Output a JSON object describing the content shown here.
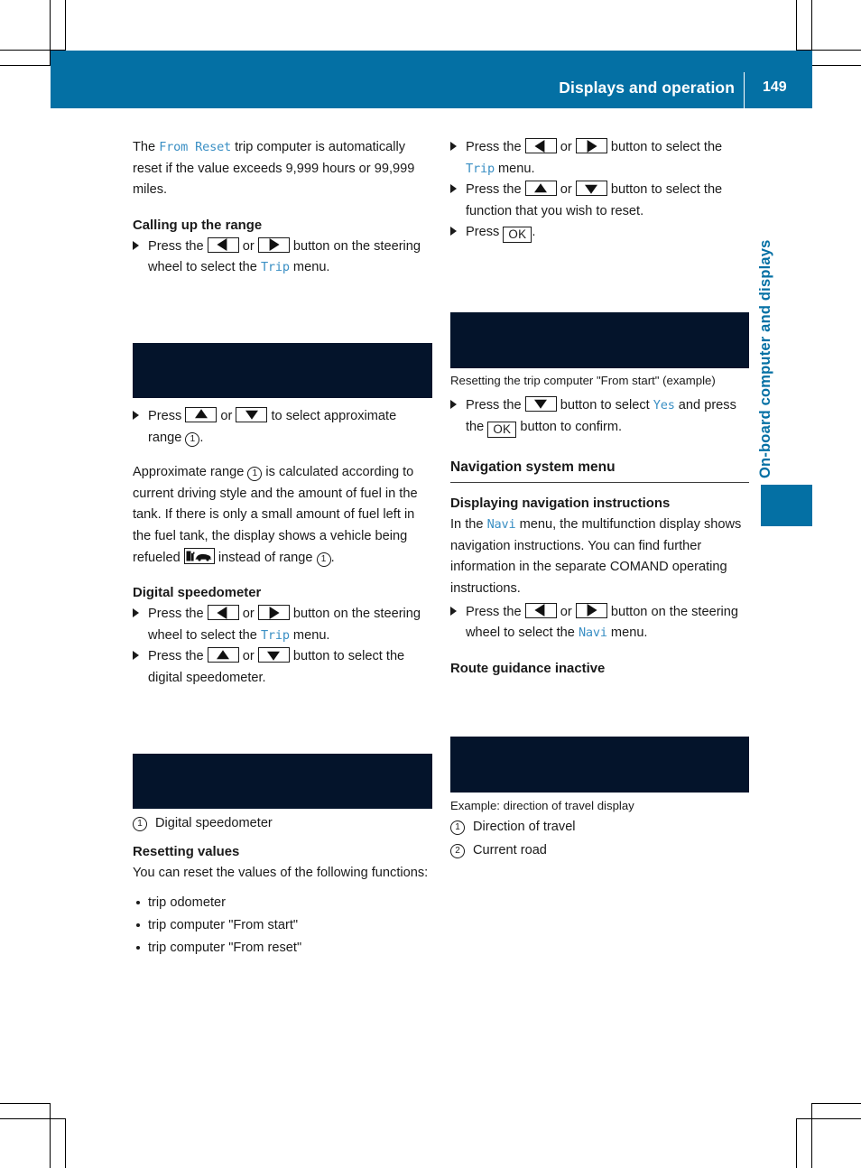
{
  "header": {
    "title": "Displays and operation",
    "page_number": "149"
  },
  "side_tab": {
    "label": "On-board computer and displays"
  },
  "left_column": {
    "intro": {
      "before": "The ",
      "code": "From Reset",
      "after": " trip computer is automatically reset if the value exceeds 9,999 hours or 99,999 miles."
    },
    "heading_calling_range": "Calling up the range",
    "step_range": {
      "t1": "Press the ",
      "t2": " or ",
      "t3": " button on the steering wheel to select the ",
      "code": "Trip",
      "t4": " menu."
    },
    "step_select_range": {
      "t1": "Press ",
      "t2": " or ",
      "t3": " to select approximate range ",
      "t4": "."
    },
    "approx_range_para": {
      "t1": "Approximate range ",
      "t2": " is calculated according to current driving style and the amount of fuel in the tank. If there is only a small amount of fuel left in the fuel tank, the display shows a vehicle being refueled ",
      "t3": " instead of range ",
      "t4": "."
    },
    "heading_digital_speedo": "Digital speedometer",
    "step_speedo_trip": {
      "t1": "Press the ",
      "t2": " or ",
      "t3": " button on the steering wheel to select the ",
      "code": "Trip",
      "t4": " menu."
    },
    "step_speedo_select": {
      "t1": "Press the ",
      "t2": " or ",
      "t3": " button to select the digital speedometer."
    },
    "legend_speedo": [
      {
        "num": "1",
        "label": "Digital speedometer"
      }
    ],
    "heading_resetting_values": "Resetting values",
    "reset_intro": "You can reset the values of the following functions:",
    "reset_list": [
      "trip odometer",
      "trip computer \"From start\"",
      "trip computer \"From reset\""
    ]
  },
  "right_column": {
    "step_trip_menu": {
      "t1": "Press the ",
      "t2": " or ",
      "t3": " button to select the ",
      "code": "Trip",
      "t4": " menu."
    },
    "step_select_function": {
      "t1": "Press the ",
      "t2": " or ",
      "t3": " button to select the function that you wish to reset."
    },
    "step_press_ok": {
      "t1": "Press ",
      "t2": "."
    },
    "caption_reset": "Resetting the trip computer \"From start\" (example)",
    "step_confirm": {
      "t1": "Press the ",
      "t2": " button to select ",
      "code": "Yes",
      "t3": " and press the ",
      "t4": " button to confirm."
    },
    "section_navigation": "Navigation system menu",
    "heading_displaying_nav": "Displaying navigation instructions",
    "nav_para": {
      "t1": "In the ",
      "code": "Navi",
      "t2": " menu, the multifunction display shows navigation instructions. You can find further information in the separate COMAND operating instructions."
    },
    "step_navi_menu": {
      "t1": "Press the ",
      "t2": " or ",
      "t3": " button on the steering wheel to select the ",
      "code": "Navi",
      "t4": " menu."
    },
    "heading_route_guidance": "Route guidance inactive",
    "caption_example": "Example: direction of travel display",
    "legend_nav": [
      {
        "num": "1",
        "label": "Direction of travel"
      },
      {
        "num": "2",
        "label": "Current road"
      }
    ]
  },
  "keys": {
    "left": "arrow-left",
    "right": "arrow-right",
    "up": "arrow-up",
    "down": "arrow-down",
    "ok": "OK"
  },
  "colors": {
    "accent_blue": "#0470a4",
    "code_blue": "#3a8fc4",
    "image_block": "#04142b"
  }
}
